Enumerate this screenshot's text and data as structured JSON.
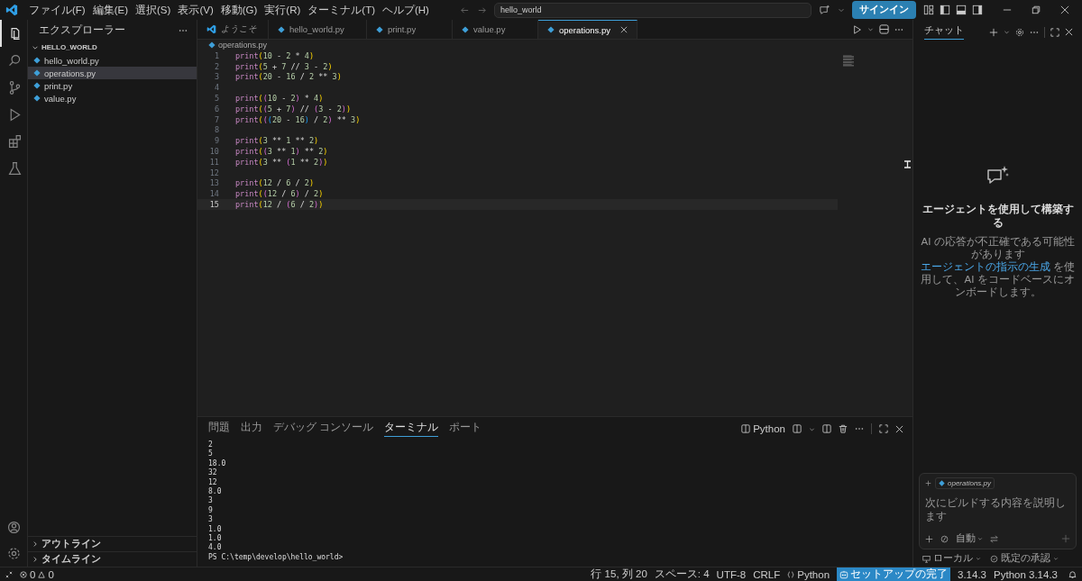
{
  "title_bar": {
    "menu": [
      "ファイル(F)",
      "編集(E)",
      "選択(S)",
      "表示(V)",
      "移動(G)",
      "実行(R)",
      "ターミナル(T)",
      "ヘルプ(H)"
    ],
    "search": {
      "value": "hello_world"
    },
    "sign_in": "サインイン"
  },
  "activity_bar": [
    {
      "kind": "files",
      "selected": true
    },
    {
      "kind": "search",
      "selected": false
    },
    {
      "kind": "source",
      "selected": false
    },
    {
      "kind": "run",
      "selected": false
    },
    {
      "kind": "extensions",
      "selected": false
    },
    {
      "kind": "testing",
      "selected": false
    }
  ],
  "sidebar": {
    "title": "エクスプローラー",
    "folder": {
      "name": "HELLO_WORLD",
      "expanded": true,
      "files": [
        {
          "name": "hello_world.py",
          "selected": false
        },
        {
          "name": "operations.py",
          "selected": true
        },
        {
          "name": "print.py",
          "selected": false
        },
        {
          "name": "value.py",
          "selected": false
        }
      ]
    },
    "sections": [
      {
        "name": "アウトライン",
        "expanded": false
      },
      {
        "name": "タイムライン",
        "expanded": false
      }
    ]
  },
  "tabs": [
    {
      "label": "ようこそ",
      "kind": "welcome",
      "selected": false
    },
    {
      "label": "hello_world.py",
      "kind": "python",
      "selected": false
    },
    {
      "label": "print.py",
      "kind": "python",
      "selected": false
    },
    {
      "label": "value.py",
      "kind": "python",
      "selected": false
    },
    {
      "label": "operations.py",
      "kind": "python",
      "selected": true
    }
  ],
  "breadcrumb": "operations.py",
  "editor": {
    "lines": [
      {
        "number": "1",
        "current": false,
        "tokens": [
          {
            "kind": "fn",
            "text": "print"
          },
          {
            "kind": "b1",
            "text": "("
          },
          {
            "kind": "num",
            "text": "10"
          },
          {
            "kind": "op",
            "text": " - "
          },
          {
            "kind": "num",
            "text": "2"
          },
          {
            "kind": "op",
            "text": " * "
          },
          {
            "kind": "num",
            "text": "4"
          },
          {
            "kind": "b1",
            "text": ")"
          }
        ]
      },
      {
        "number": "2",
        "current": false,
        "tokens": [
          {
            "kind": "fn",
            "text": "print"
          },
          {
            "kind": "b1",
            "text": "("
          },
          {
            "kind": "num",
            "text": "5"
          },
          {
            "kind": "op",
            "text": " + "
          },
          {
            "kind": "num",
            "text": "7"
          },
          {
            "kind": "op",
            "text": " // "
          },
          {
            "kind": "num",
            "text": "3"
          },
          {
            "kind": "op",
            "text": " - "
          },
          {
            "kind": "num",
            "text": "2"
          },
          {
            "kind": "b1",
            "text": ")"
          }
        ]
      },
      {
        "number": "3",
        "current": false,
        "tokens": [
          {
            "kind": "fn",
            "text": "print"
          },
          {
            "kind": "b1",
            "text": "("
          },
          {
            "kind": "num",
            "text": "20"
          },
          {
            "kind": "op",
            "text": " - "
          },
          {
            "kind": "num",
            "text": "16"
          },
          {
            "kind": "op",
            "text": " / "
          },
          {
            "kind": "num",
            "text": "2"
          },
          {
            "kind": "op",
            "text": " ** "
          },
          {
            "kind": "num",
            "text": "3"
          },
          {
            "kind": "b1",
            "text": ")"
          }
        ]
      },
      {
        "number": "4",
        "current": false
      },
      {
        "number": "5",
        "current": false,
        "tokens": [
          {
            "kind": "fn",
            "text": "print"
          },
          {
            "kind": "b1",
            "text": "("
          },
          {
            "kind": "b2",
            "text": "("
          },
          {
            "kind": "num",
            "text": "10"
          },
          {
            "kind": "op",
            "text": " - "
          },
          {
            "kind": "num",
            "text": "2"
          },
          {
            "kind": "b2",
            "text": ")"
          },
          {
            "kind": "op",
            "text": " * "
          },
          {
            "kind": "num",
            "text": "4"
          },
          {
            "kind": "b1",
            "text": ")"
          }
        ]
      },
      {
        "number": "6",
        "current": false,
        "tokens": [
          {
            "kind": "fn",
            "text": "print"
          },
          {
            "kind": "b1",
            "text": "("
          },
          {
            "kind": "b2",
            "text": "("
          },
          {
            "kind": "num",
            "text": "5"
          },
          {
            "kind": "op",
            "text": " + "
          },
          {
            "kind": "num",
            "text": "7"
          },
          {
            "kind": "b2",
            "text": ")"
          },
          {
            "kind": "op",
            "text": " // "
          },
          {
            "kind": "b2",
            "text": "("
          },
          {
            "kind": "num",
            "text": "3"
          },
          {
            "kind": "op",
            "text": " - "
          },
          {
            "kind": "num",
            "text": "2"
          },
          {
            "kind": "b2",
            "text": ")"
          },
          {
            "kind": "b1",
            "text": ")"
          }
        ]
      },
      {
        "number": "7",
        "current": false,
        "tokens": [
          {
            "kind": "fn",
            "text": "print"
          },
          {
            "kind": "b1",
            "text": "("
          },
          {
            "kind": "b2",
            "text": "("
          },
          {
            "kind": "b3",
            "text": "("
          },
          {
            "kind": "num",
            "text": "20"
          },
          {
            "kind": "op",
            "text": " - "
          },
          {
            "kind": "num",
            "text": "16"
          },
          {
            "kind": "b3",
            "text": ")"
          },
          {
            "kind": "op",
            "text": " / "
          },
          {
            "kind": "num",
            "text": "2"
          },
          {
            "kind": "b2",
            "text": ")"
          },
          {
            "kind": "op",
            "text": " ** "
          },
          {
            "kind": "num",
            "text": "3"
          },
          {
            "kind": "b1",
            "text": ")"
          }
        ]
      },
      {
        "number": "8",
        "current": false
      },
      {
        "number": "9",
        "current": false,
        "tokens": [
          {
            "kind": "fn",
            "text": "print"
          },
          {
            "kind": "b1",
            "text": "("
          },
          {
            "kind": "num",
            "text": "3"
          },
          {
            "kind": "op",
            "text": " ** "
          },
          {
            "kind": "num",
            "text": "1"
          },
          {
            "kind": "op",
            "text": " ** "
          },
          {
            "kind": "num",
            "text": "2"
          },
          {
            "kind": "b1",
            "text": ")"
          }
        ]
      },
      {
        "number": "10",
        "current": false,
        "tokens": [
          {
            "kind": "fn",
            "text": "print"
          },
          {
            "kind": "b1",
            "text": "("
          },
          {
            "kind": "b2",
            "text": "("
          },
          {
            "kind": "num",
            "text": "3"
          },
          {
            "kind": "op",
            "text": " ** "
          },
          {
            "kind": "num",
            "text": "1"
          },
          {
            "kind": "b2",
            "text": ")"
          },
          {
            "kind": "op",
            "text": " ** "
          },
          {
            "kind": "num",
            "text": "2"
          },
          {
            "kind": "b1",
            "text": ")"
          }
        ]
      },
      {
        "number": "11",
        "current": false,
        "tokens": [
          {
            "kind": "fn",
            "text": "print"
          },
          {
            "kind": "b1",
            "text": "("
          },
          {
            "kind": "num",
            "text": "3"
          },
          {
            "kind": "op",
            "text": " ** "
          },
          {
            "kind": "b2",
            "text": "("
          },
          {
            "kind": "num",
            "text": "1"
          },
          {
            "kind": "op",
            "text": " ** "
          },
          {
            "kind": "num",
            "text": "2"
          },
          {
            "kind": "b2",
            "text": ")"
          },
          {
            "kind": "b1",
            "text": ")"
          }
        ]
      },
      {
        "number": "12",
        "current": false
      },
      {
        "number": "13",
        "current": false,
        "tokens": [
          {
            "kind": "fn",
            "text": "print"
          },
          {
            "kind": "b1",
            "text": "("
          },
          {
            "kind": "num",
            "text": "12"
          },
          {
            "kind": "op",
            "text": " / "
          },
          {
            "kind": "num",
            "text": "6"
          },
          {
            "kind": "op",
            "text": " / "
          },
          {
            "kind": "num",
            "text": "2"
          },
          {
            "kind": "b1",
            "text": ")"
          }
        ]
      },
      {
        "number": "14",
        "current": false,
        "tokens": [
          {
            "kind": "fn",
            "text": "print"
          },
          {
            "kind": "b1",
            "text": "("
          },
          {
            "kind": "b2",
            "text": "("
          },
          {
            "kind": "num",
            "text": "12"
          },
          {
            "kind": "op",
            "text": " / "
          },
          {
            "kind": "num",
            "text": "6"
          },
          {
            "kind": "b2",
            "text": ")"
          },
          {
            "kind": "op",
            "text": " / "
          },
          {
            "kind": "num",
            "text": "2"
          },
          {
            "kind": "b1",
            "text": ")"
          }
        ]
      },
      {
        "number": "15",
        "current": true,
        "tokens": [
          {
            "kind": "fn",
            "text": "print"
          },
          {
            "kind": "b1",
            "text": "("
          },
          {
            "kind": "num",
            "text": "12"
          },
          {
            "kind": "op",
            "text": " / "
          },
          {
            "kind": "b2",
            "text": "("
          },
          {
            "kind": "num",
            "text": "6"
          },
          {
            "kind": "op",
            "text": " / "
          },
          {
            "kind": "num",
            "text": "2"
          },
          {
            "kind": "b2",
            "text": ")"
          },
          {
            "kind": "b1",
            "text": ")"
          }
        ]
      }
    ]
  },
  "panel": {
    "tabs": [
      {
        "label": "問題",
        "selected": false
      },
      {
        "label": "出力",
        "selected": false
      },
      {
        "label": "デバッグ コンソール",
        "selected": false
      },
      {
        "label": "ターミナル",
        "selected": true
      },
      {
        "label": "ポート",
        "selected": false
      }
    ],
    "profile": "Python",
    "output": [
      "2",
      "5",
      "18.0",
      "32",
      "12",
      "8.0",
      "3",
      "9",
      "3",
      "1.0",
      "1.0",
      "4.0"
    ],
    "prompt": "PS C:\\temp\\develop\\hello_world>"
  },
  "chat": {
    "title": "チャット",
    "heading": "エージェントを使用して構築する",
    "note": "AI の応答が不正確である可能性があります",
    "link": "エージェントの指示の生成",
    "after_link": " を使用して、AI をコードベースにオンボードします。",
    "attachment": "operations.py",
    "placeholder": "次にビルドする内容を説明します",
    "mode": "自動",
    "footer": [
      "ローカル",
      "既定の承認"
    ]
  },
  "status_bar": {
    "errors": "0",
    "warnings": "0",
    "items": [
      "行 15, 列 20",
      "スペース: 4",
      "UTF-8",
      "CRLF"
    ],
    "language": "Python",
    "setup": "セットアップの完了",
    "version": "3.14.3",
    "interpreter": "Python 3.14.3"
  }
}
